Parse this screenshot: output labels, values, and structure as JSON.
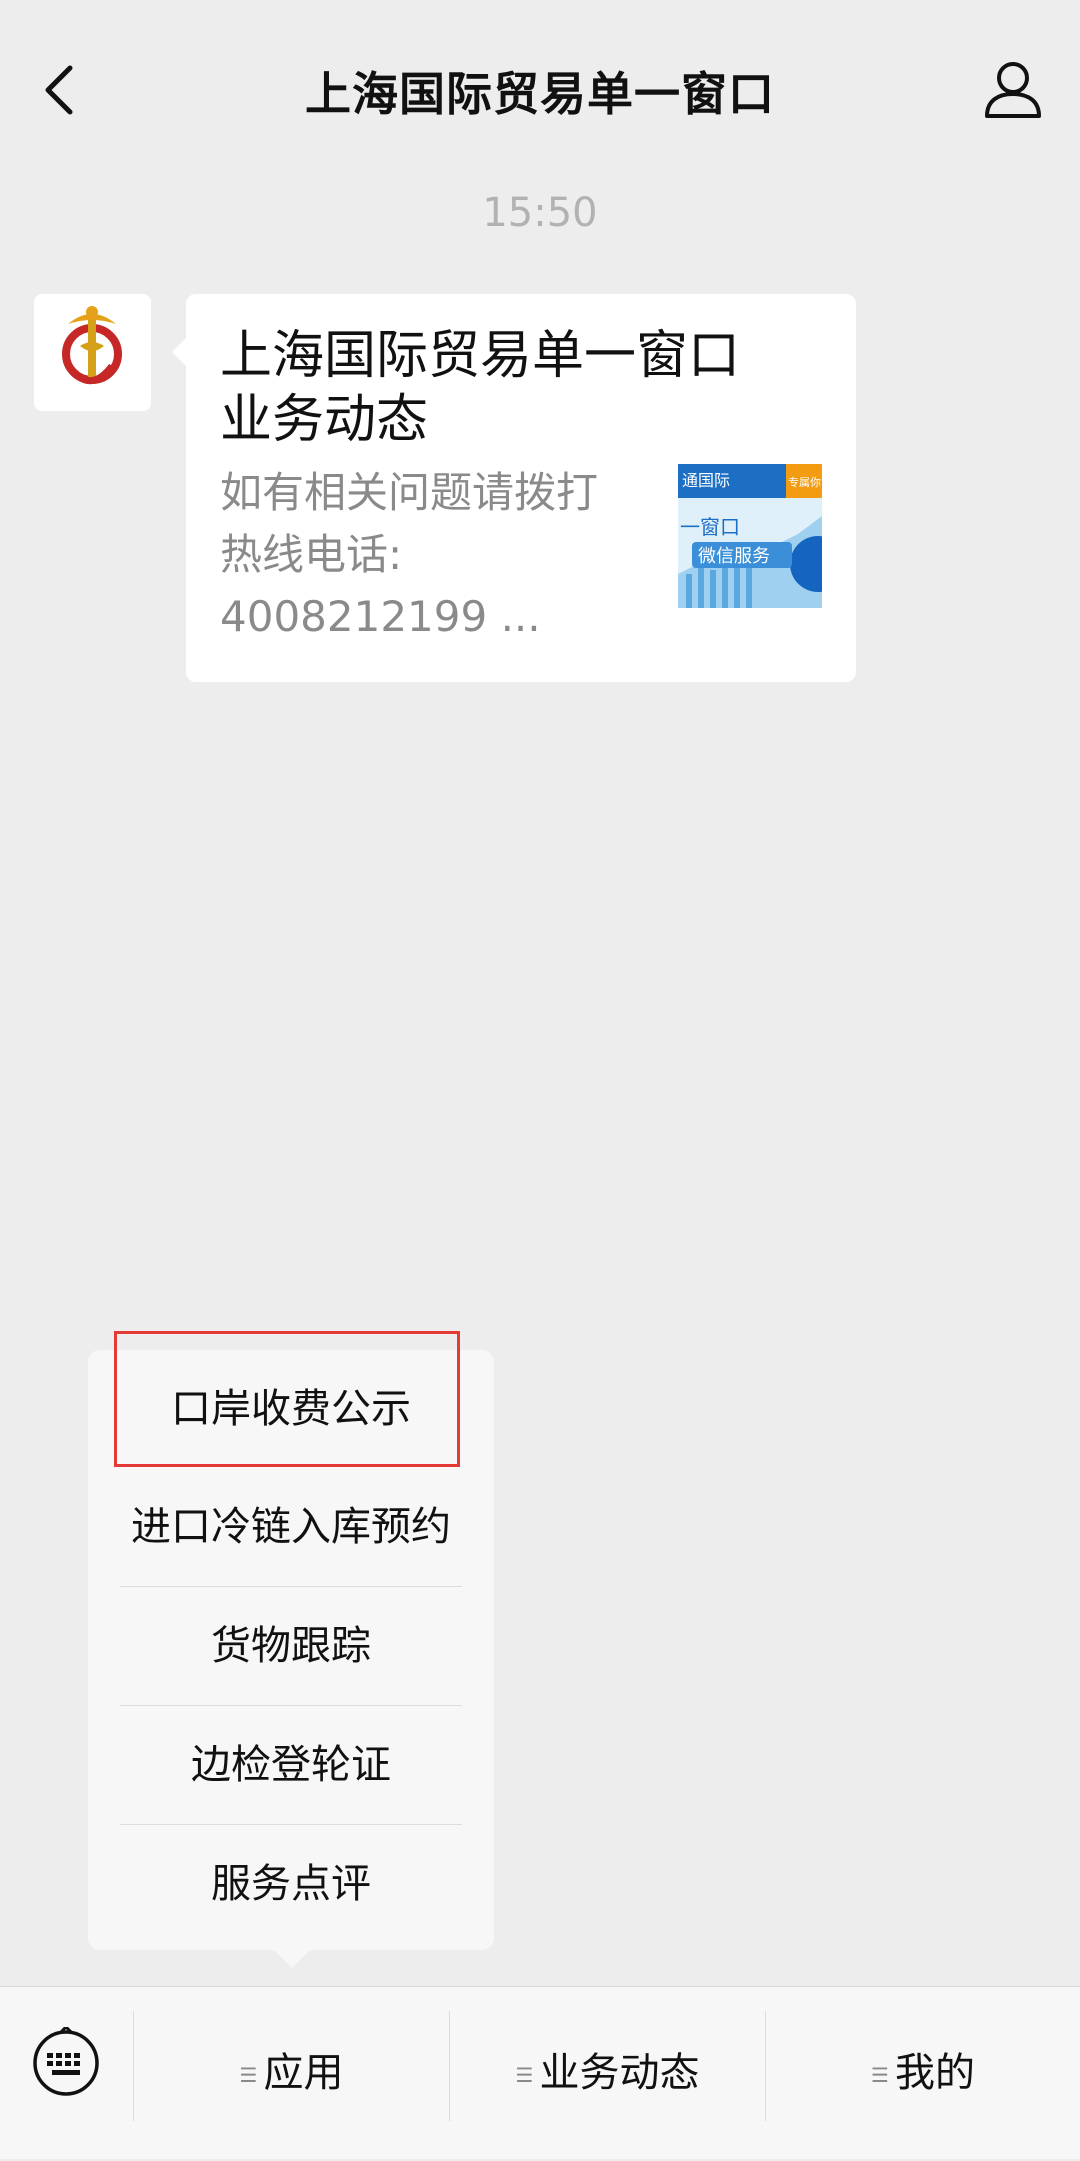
{
  "header": {
    "title": "上海国际贸易单一窗口"
  },
  "chat": {
    "timestamp": "15:50",
    "card": {
      "title_line1": "上海国际贸易单一窗口",
      "title_line2": "业务动态",
      "desc_line1": "如有相关问题请拨打",
      "desc_line2": "热线电话:",
      "desc_line3": "4008212199 ...",
      "thumbnail": {
        "top_text": "通国际",
        "badge": "专属你",
        "line1": "一窗口",
        "line2": "微信服务"
      }
    }
  },
  "popup_menu": {
    "items": [
      "口岸收费公示",
      "进口冷链入库预约",
      "货物跟踪",
      "边检登轮证",
      "服务点评"
    ]
  },
  "bottom_menu": {
    "keyboard_icon": "keyboard-icon",
    "items": [
      {
        "label": "应用"
      },
      {
        "label": "业务动态"
      },
      {
        "label": "我的"
      }
    ]
  },
  "colors": {
    "highlight": "#e53935",
    "background": "#ededed"
  }
}
